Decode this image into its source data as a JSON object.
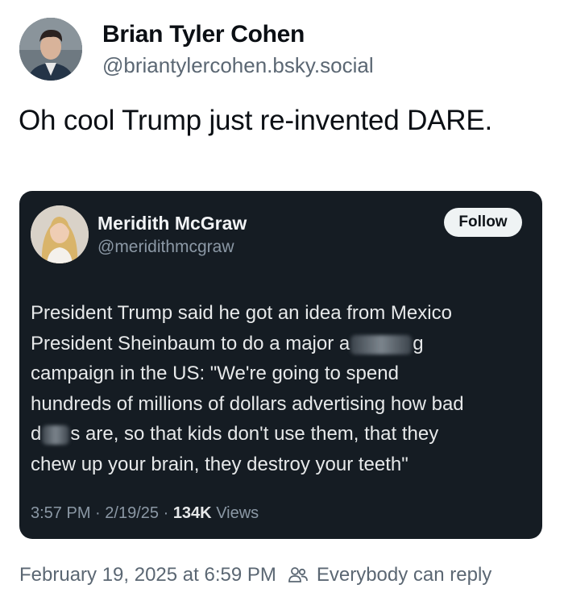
{
  "post": {
    "author_name": "Brian Tyler Cohen",
    "author_handle": "@briantylercohen.bsky.social",
    "text": "Oh cool Trump just re-invented DARE.",
    "date_time": "February 19, 2025 at 6:59 PM",
    "reply_setting": "Everybody can reply"
  },
  "quote": {
    "author_name": "Meridith McGraw",
    "author_handle": "@meridithmcgraw",
    "follow_label": "Follow",
    "body": {
      "line1": "President Trump said he got an idea from Mexico",
      "line2a": "President Sheinbaum to do a major a",
      "line2b": "g",
      "line3": "campaign in the US: \"We're going to spend",
      "line4": "hundreds of millions of dollars advertising how bad",
      "line5a": "d",
      "line5b": "s are, so that kids don't use them, that they",
      "line6": "chew up your brain, they destroy your teeth\""
    },
    "time": "3:57 PM",
    "date": "2/19/25",
    "views_count": "134K",
    "views_label": "Views",
    "separator": "·"
  },
  "icons": {
    "author_avatar": "avatar",
    "quote_avatar": "avatar",
    "reply_setting_icon": "people-icon"
  }
}
